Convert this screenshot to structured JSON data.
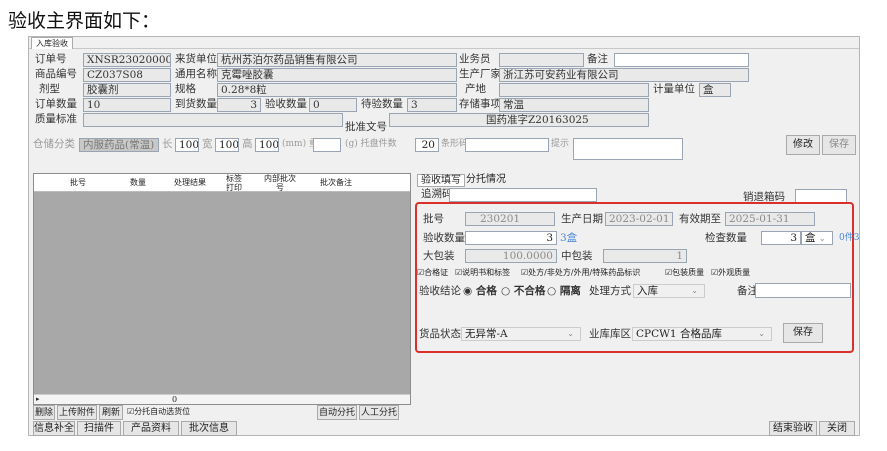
{
  "heading": "验收主界面如下：",
  "tab": "入库验收",
  "fields": {
    "order_no_label": "订单号",
    "order_no": "XNSR2302000002",
    "supplier_label": "来货单位",
    "supplier": "杭州苏泊尔药品销售有限公司",
    "salesman_label": "业务员",
    "salesman": "",
    "remark_label": "备注",
    "remark": "",
    "product_code_label": "商品编号",
    "product_code": "CZ037S08",
    "generic_label": "通用名称",
    "generic": "克霉唑胶囊",
    "manufacturer_label": "生产厂家",
    "manufacturer": "浙江苏可安药业有限公司",
    "dosage_label": "剂型",
    "dosage": "胶囊剂",
    "spec_label": "规格",
    "spec": "0.28*8粒",
    "origin_label": "产地",
    "origin": "",
    "unit_label": "计量单位",
    "unit": "盒",
    "order_qty_label": "订单数量",
    "order_qty": "10",
    "arrival_qty_label": "到货数量",
    "arrival_qty": "3",
    "checked_qty_label": "验收数量",
    "checked_qty": "0",
    "pending_qty_label": "待验数量",
    "pending_qty": "3",
    "storage_label": "存储事项",
    "storage": "常温",
    "quality_std_label": "质量标准",
    "quality_std": "",
    "approval_label": "批准文号",
    "approval": "国药准字Z20163025",
    "storage_class_label": "仓储分类",
    "storage_class": "内服药品(常温)",
    "length_label": "长",
    "length": "100",
    "width_label": "宽",
    "width": "100",
    "height_label": "高",
    "height": "100",
    "mm_label": "(mm) 重",
    "weight": "",
    "pallet_label": "(g) 托盘件数",
    "pallet": "20",
    "barcode_label": "条形码",
    "barcode": "",
    "hint_label": "提示",
    "hint": "",
    "modify_btn": "修改",
    "save_btn": "保存"
  },
  "grid": {
    "columns": [
      "批号",
      "数量",
      "处理结果",
      "标签打印",
      "内部批次号",
      "批次备注"
    ],
    "total": "0"
  },
  "bottom_left": {
    "delete": "删除",
    "upload": "上传附件",
    "refresh": "刷新",
    "auto_pallet_check": "分托自动选货位",
    "auto_split": "自动分托",
    "manual_split": "人工分托",
    "info_fill": "信息补全",
    "scan": "扫描件",
    "product_info": "产品资料",
    "batch_info": "批次信息"
  },
  "acceptance": {
    "tab1": "验收填写",
    "tab2": "分托情况",
    "trace_label": "追溯码",
    "trace": "",
    "return_label": "销退箱码",
    "return": "",
    "batch_label": "批号",
    "batch": "230201",
    "prod_date_label": "生产日期",
    "prod_date": "2023-02-01",
    "expiry_label": "有效期至",
    "expiry": "2025-01-31",
    "accept_qty_label": "验收数量",
    "accept_qty": "3",
    "accept_hint": "3盒",
    "check_qty_label": "检查数量",
    "check_qty": "3",
    "check_unit": "盒",
    "check_hint": "0件3盒",
    "big_pack_label": "大包装",
    "big_pack": "100.0000",
    "mid_pack_label": "中包装",
    "mid_pack": "1",
    "checks": [
      "合格证",
      "说明书和标签",
      "处方/非处方/外用/特殊药品标识",
      "包装质量",
      "外观质量"
    ],
    "conclusion_label": "验收结论",
    "conclusions": [
      "合格",
      "不合格",
      "隔离"
    ],
    "handling_label": "处理方式",
    "handling": "入库",
    "remark_label": "备注",
    "remark": "",
    "goods_status_label": "货品状态",
    "goods_status": "无异常-A",
    "area_label": "业库库区",
    "area": "CPCW1 合格品库",
    "save": "保存"
  },
  "bottom_right": {
    "finish": "结束验收",
    "close": "关闭"
  }
}
